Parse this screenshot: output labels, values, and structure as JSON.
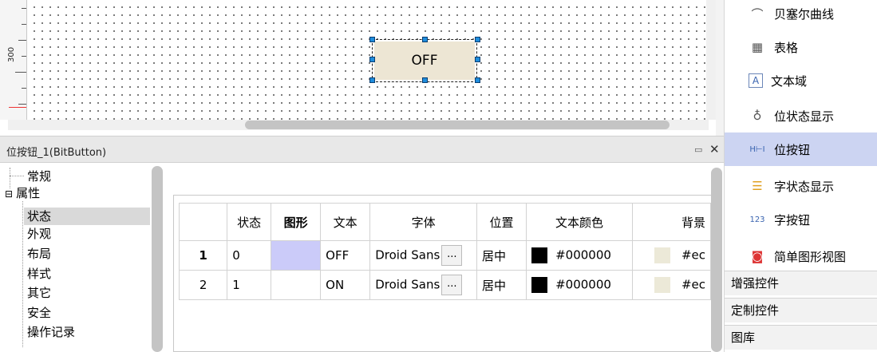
{
  "canvas": {
    "ruler_label": "300",
    "widget_text": "OFF"
  },
  "props": {
    "title": "位按钮_1(BitButton)",
    "float_icon": "restore-window-icon",
    "close_icon": "close-icon",
    "close_glyph": "✕"
  },
  "tree": {
    "items": [
      {
        "label": "常规"
      },
      {
        "label": "属性",
        "expand": "⊟"
      },
      {
        "label": "状态"
      },
      {
        "label": "外观"
      },
      {
        "label": "布局"
      },
      {
        "label": "样式"
      },
      {
        "label": "其它"
      },
      {
        "label": "安全"
      },
      {
        "label": "操作记录"
      }
    ]
  },
  "table": {
    "headers": [
      "",
      "状态",
      "图形",
      "文本",
      "字体",
      "位置",
      "文本颜色",
      "背景"
    ],
    "rows": [
      {
        "num": "1",
        "state": "0",
        "text": "OFF",
        "font": "Droid Sans",
        "font_btn": "...",
        "position": "居中",
        "text_color": "#000000",
        "bg": "#ec"
      },
      {
        "num": "2",
        "state": "1",
        "text": "ON",
        "font": "Droid Sans",
        "font_btn": "...",
        "position": "居中",
        "text_color": "#000000",
        "bg": "#ec"
      }
    ],
    "colors": {
      "graphic_selected": "#cbcbf9",
      "text_swatch": "#000000",
      "bg_swatch": "#ece9d8"
    }
  },
  "toolbox": {
    "items": [
      {
        "label": "贝塞尔曲线",
        "icon": "bezier-curve-icon"
      },
      {
        "label": "表格",
        "icon": "table-icon"
      },
      {
        "label": "文本域",
        "icon": "text-field-icon"
      },
      {
        "label": "位状态显示",
        "icon": "lightbulb-icon"
      },
      {
        "label": "位按钮",
        "icon": "bit-button-icon"
      },
      {
        "label": "字状态显示",
        "icon": "traffic-light-icon"
      },
      {
        "label": "字按钮",
        "icon": "word-button-icon"
      },
      {
        "label": "简单图形视图",
        "icon": "graphic-view-icon"
      }
    ],
    "sections": [
      "增强控件",
      "定制控件",
      "图库"
    ],
    "selected_color": "#ccd4f2"
  }
}
